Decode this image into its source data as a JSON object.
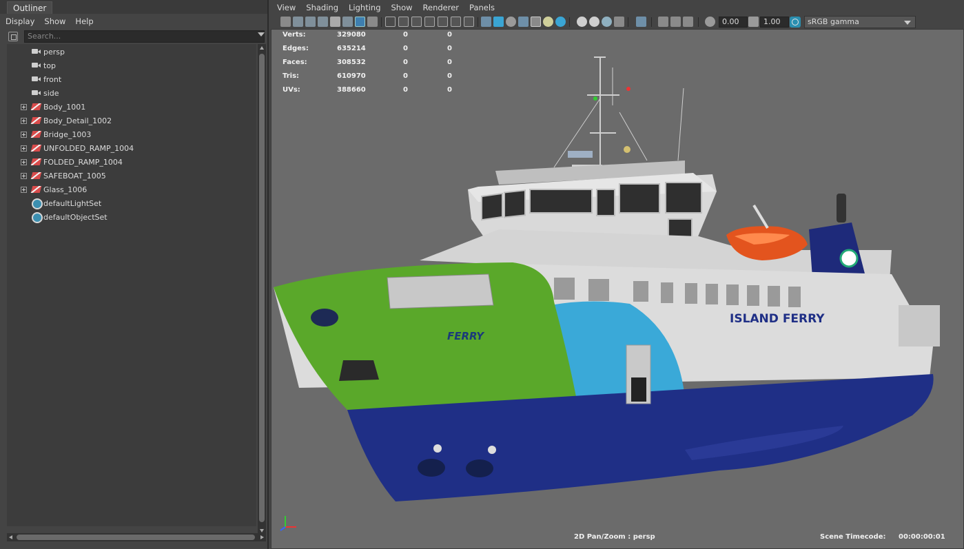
{
  "outliner": {
    "tab": "Outliner",
    "menu": [
      "Display",
      "Show",
      "Help"
    ],
    "search_placeholder": "Search...",
    "items": [
      {
        "label": "persp",
        "icon": "camera-icon"
      },
      {
        "label": "top",
        "icon": "camera-icon"
      },
      {
        "label": "front",
        "icon": "camera-icon"
      },
      {
        "label": "side",
        "icon": "camera-icon"
      },
      {
        "label": "Body_1001",
        "icon": "mesh-group-icon"
      },
      {
        "label": "Body_Detail_1002",
        "icon": "mesh-group-icon"
      },
      {
        "label": "Bridge_1003",
        "icon": "mesh-group-icon"
      },
      {
        "label": "UNFOLDED_RAMP_1004",
        "icon": "mesh-group-icon"
      },
      {
        "label": "FOLDED_RAMP_1004",
        "icon": "mesh-group-icon"
      },
      {
        "label": "SAFEBOAT_1005",
        "icon": "mesh-group-icon"
      },
      {
        "label": "Glass_1006",
        "icon": "mesh-group-icon"
      },
      {
        "label": "defaultLightSet",
        "icon": "set-icon"
      },
      {
        "label": "defaultObjectSet",
        "icon": "set-icon"
      }
    ]
  },
  "viewport": {
    "menu": [
      "View",
      "Shading",
      "Lighting",
      "Show",
      "Renderer",
      "Panels"
    ],
    "exposure": "0.00",
    "gamma": "1.00",
    "colorspace": "sRGB gamma",
    "hud": [
      {
        "label": "Verts:",
        "values": [
          "329080",
          "0",
          "0"
        ]
      },
      {
        "label": "Edges:",
        "values": [
          "635214",
          "0",
          "0"
        ]
      },
      {
        "label": "Faces:",
        "values": [
          "308532",
          "0",
          "0"
        ]
      },
      {
        "label": "Tris:",
        "values": [
          "610970",
          "0",
          "0"
        ]
      },
      {
        "label": "UVs:",
        "values": [
          "388660",
          "0",
          "0"
        ]
      }
    ],
    "ship_name": "ISLAND FERRY",
    "bow_name": "FERRY",
    "camera_status": "2D Pan/Zoom : persp",
    "timecode_label": "Scene Timecode:",
    "timecode_value": "00:00:00:01",
    "colors": {
      "viewport_bg": "#6b6b6b",
      "hull_blue": "#1f2f86",
      "bow_green": "#5aa82a",
      "cyan": "#3aa9d8",
      "superstructure": "#d9d9d9",
      "lifeboat": "#e3541e"
    }
  }
}
